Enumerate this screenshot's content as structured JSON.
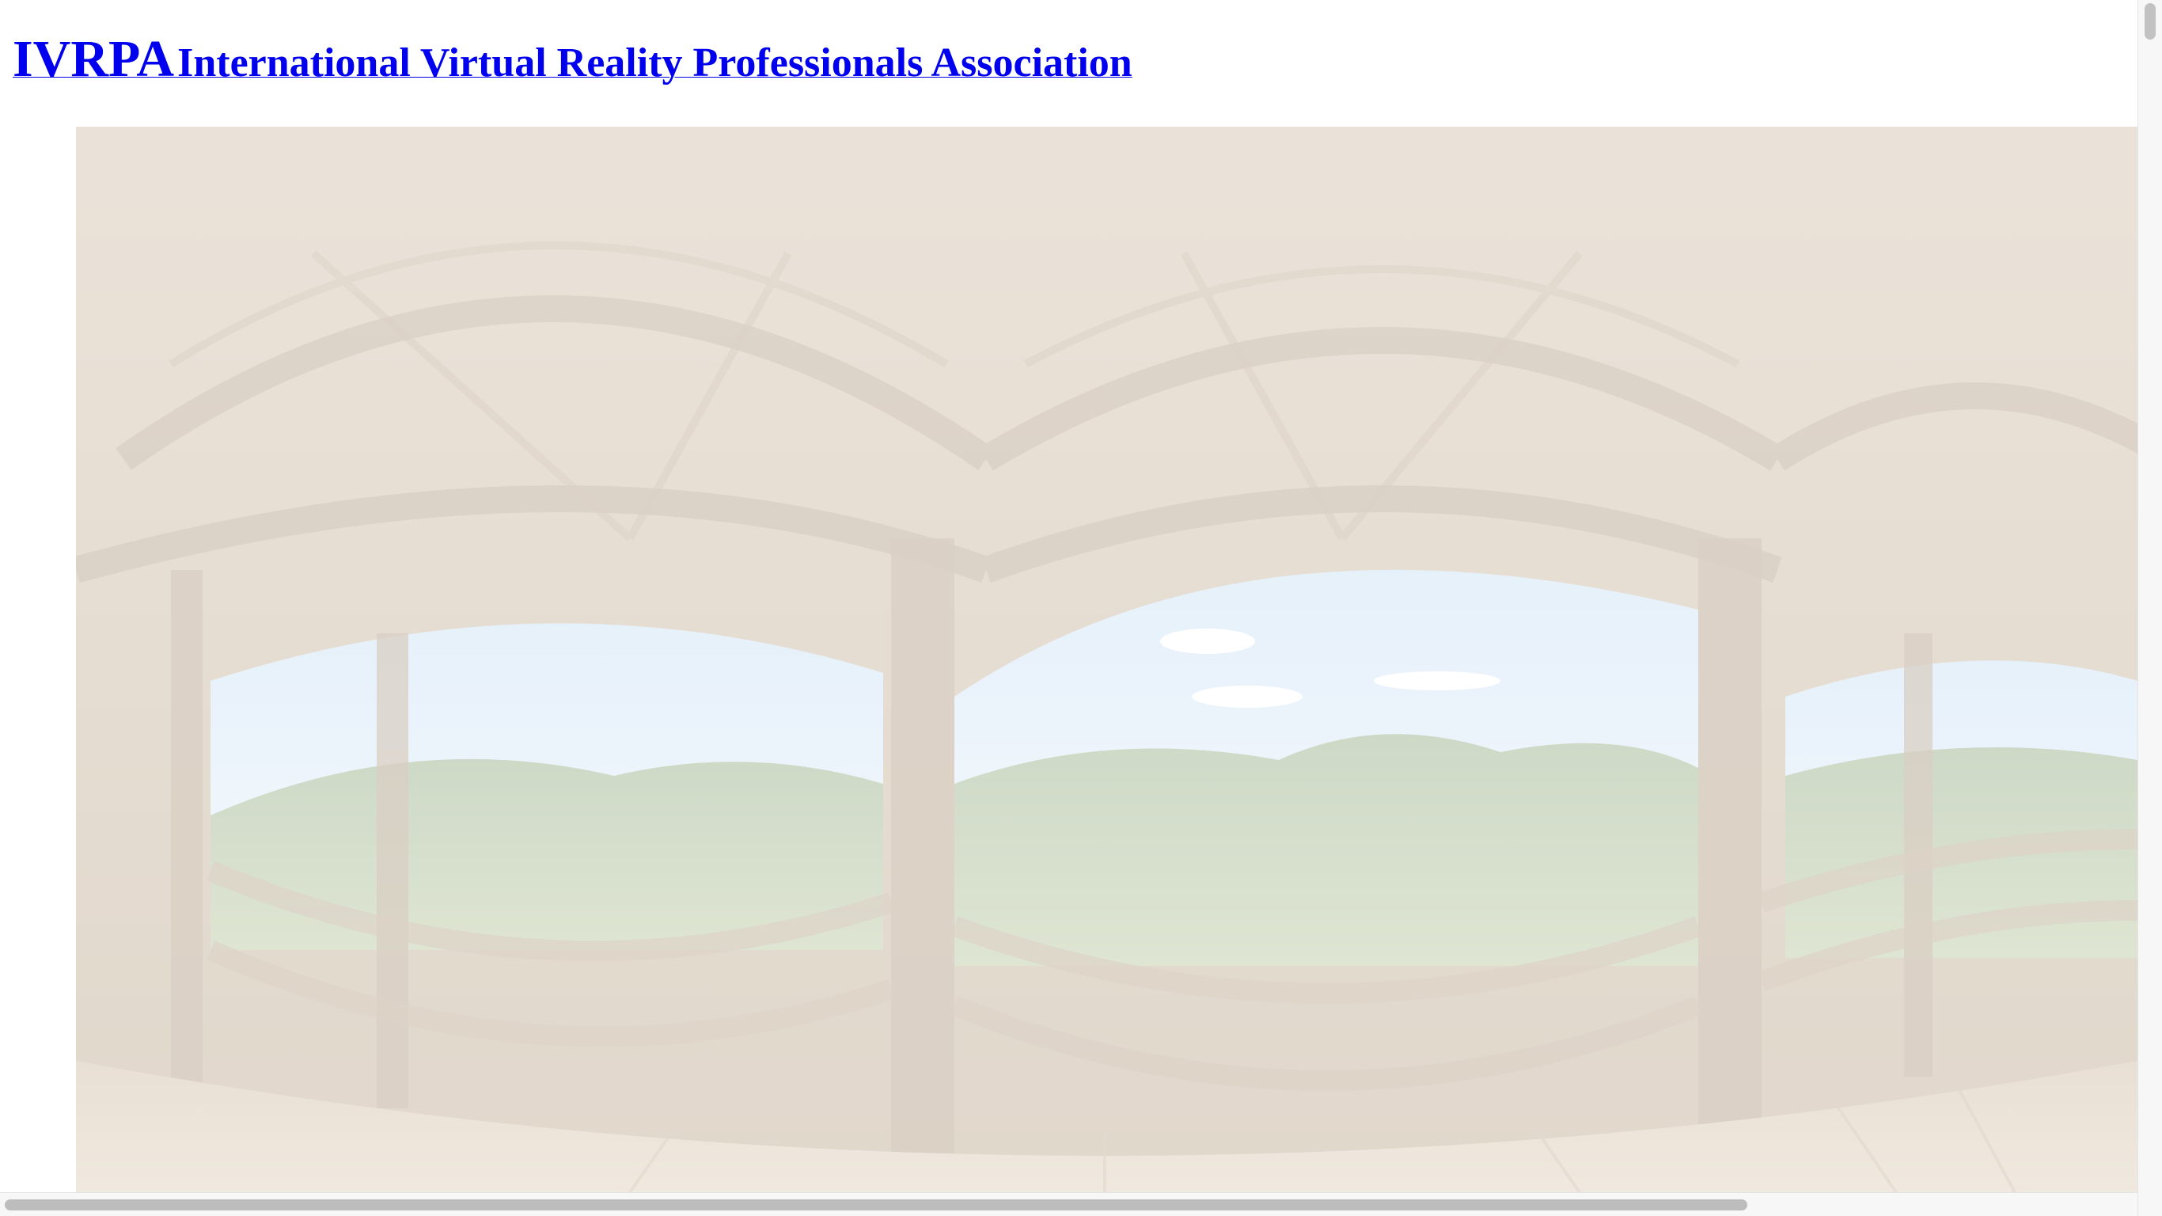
{
  "header": {
    "abbreviation": "IVRPA",
    "full_name": "International Virtual Reality Professionals Association"
  },
  "panorama": {
    "alt": ""
  },
  "colors": {
    "link": "#0000ee",
    "scrollbar_thumb": "#c2c2c2",
    "scrollbar_track": "#f7f7f7"
  }
}
